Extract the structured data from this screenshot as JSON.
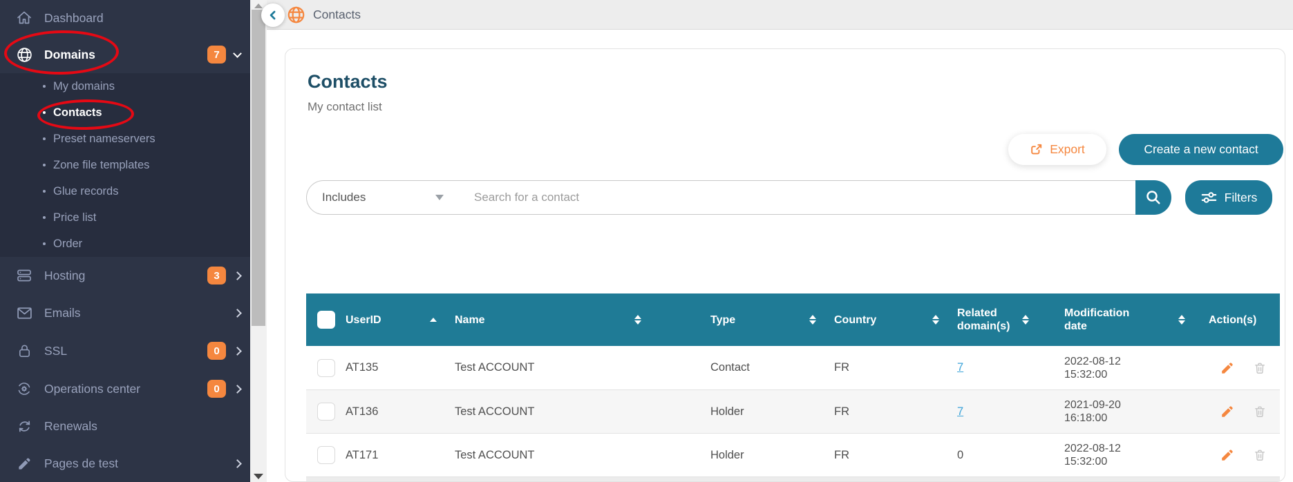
{
  "sidebar": {
    "items": [
      {
        "label": "Dashboard"
      },
      {
        "label": "Domains",
        "badge": "7"
      },
      {
        "label": "Hosting",
        "badge": "3"
      },
      {
        "label": "Emails"
      },
      {
        "label": "SSL",
        "badge": "0"
      },
      {
        "label": "Operations center",
        "badge": "0"
      },
      {
        "label": "Renewals"
      },
      {
        "label": "Pages de test"
      }
    ],
    "submenu": [
      {
        "label": "My domains"
      },
      {
        "label": "Contacts"
      },
      {
        "label": "Preset nameservers"
      },
      {
        "label": "Zone file templates"
      },
      {
        "label": "Glue records"
      },
      {
        "label": "Price list"
      },
      {
        "label": "Order"
      }
    ]
  },
  "topbar": {
    "breadcrumb": "Contacts"
  },
  "page": {
    "title": "Contacts",
    "subtitle": "My contact list"
  },
  "actions": {
    "export_label": "Export",
    "create_label": "Create a new contact",
    "filters_label": "Filters"
  },
  "search": {
    "mode_value": "Includes",
    "placeholder": "Search for a contact"
  },
  "table": {
    "columns": [
      {
        "label": "UserID",
        "sort": "asc"
      },
      {
        "label": "Name",
        "sort": "both"
      },
      {
        "label": "Type",
        "sort": "both"
      },
      {
        "label": "Country",
        "sort": "both"
      },
      {
        "label": "Related domain(s)",
        "sort": "both"
      },
      {
        "label": "Modification date",
        "sort": "both"
      },
      {
        "label": "Action(s)",
        "sort": "none"
      }
    ],
    "rows": [
      {
        "user_id": "AT135",
        "name": "Test ACCOUNT",
        "type": "Contact",
        "country": "FR",
        "related": "7",
        "related_is_link": true,
        "modified_date": "2022-08-12",
        "modified_time": "15:32:00"
      },
      {
        "user_id": "AT136",
        "name": "Test ACCOUNT",
        "type": "Holder",
        "country": "FR",
        "related": "7",
        "related_is_link": true,
        "modified_date": "2021-09-20",
        "modified_time": "16:18:00"
      },
      {
        "user_id": "AT171",
        "name": "Test ACCOUNT",
        "type": "Holder",
        "country": "FR",
        "related": "0",
        "related_is_link": false,
        "modified_date": "2022-08-12",
        "modified_time": "15:32:00"
      }
    ]
  },
  "annotations": {
    "circled_items": [
      "Domains",
      "Contacts"
    ],
    "color": "#e50914"
  },
  "colors": {
    "teal": "#1f7b96",
    "accent_orange": "#f5873f",
    "sidebar_bg": "#2d3446",
    "submenu_bg": "#272d3e",
    "link_blue": "#3ba3d9",
    "topbar_bg": "#ededed"
  }
}
